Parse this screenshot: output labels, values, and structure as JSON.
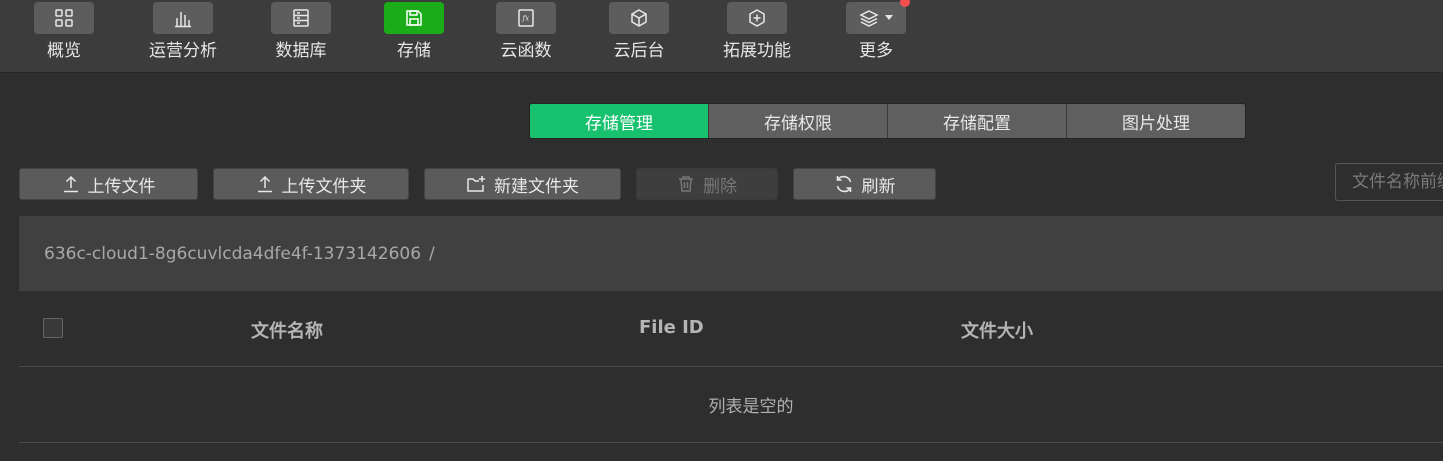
{
  "toolbar": {
    "items": [
      {
        "label": "概览",
        "icon": "overview-grid-icon"
      },
      {
        "label": "运营分析",
        "icon": "bar-chart-icon"
      },
      {
        "label": "数据库",
        "icon": "database-icon"
      },
      {
        "label": "存储",
        "icon": "storage-save-icon",
        "active": true
      },
      {
        "label": "云函数",
        "icon": "function-fx-icon"
      },
      {
        "label": "云后台",
        "icon": "cube-icon"
      },
      {
        "label": "拓展功能",
        "icon": "extension-plus-icon"
      },
      {
        "label": "更多",
        "icon": "layers-icon",
        "has_dropdown": true,
        "has_notification_dot": true
      }
    ]
  },
  "tabs": [
    {
      "label": "存储管理",
      "active": true
    },
    {
      "label": "存储权限"
    },
    {
      "label": "存储配置"
    },
    {
      "label": "图片处理"
    }
  ],
  "actions": {
    "upload_file": "上传文件",
    "upload_folder": "上传文件夹",
    "new_folder": "新建文件夹",
    "delete": "删除",
    "refresh": "刷新"
  },
  "search": {
    "placeholder": "文件名称前缀"
  },
  "path": {
    "bucket": "636c-cloud1-8g6cuvlcda4dfe4f-1373142606",
    "separator": "/"
  },
  "table": {
    "columns": [
      "文件名称",
      "File ID",
      "文件大小"
    ],
    "empty_text": "列表是空的"
  },
  "colors": {
    "accent_green": "#17c16e",
    "active_tool_green": "#1aad19",
    "notification_red": "#f04f4f",
    "background": "#2e2e2e"
  }
}
